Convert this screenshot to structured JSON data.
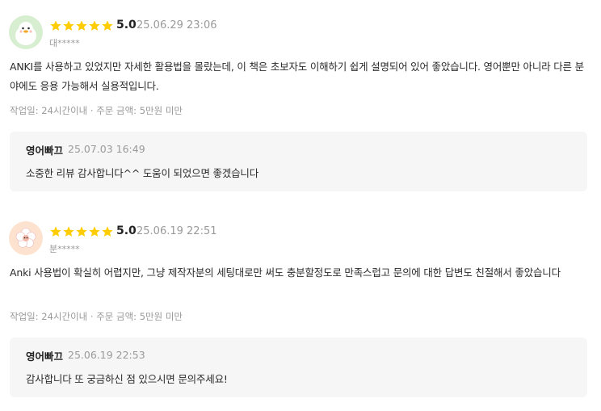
{
  "reviews": [
    {
      "avatar": "duck-avatar-icon",
      "rating": "5.0",
      "stars": 5,
      "date": "25.06.29 23:06",
      "user": "대*****",
      "text": "ANKI를 사용하고 있었지만 자세한 활용법을 몰랐는데, 이 책은 초보자도 이해하기 쉽게 설명되어 있어 좋았습니다. 영어뿐만 아니라 다른 분야에도 응용 가능해서 실용적입니다.",
      "meta": "작업일: 24시간이내 · 주문 금액: 5만원 미만",
      "reply": {
        "name": "영어빠끄",
        "date": "25.07.03 16:49",
        "text": "소중한 리뷰 감사합니다^^ 도움이 되었으면 좋겠습니다"
      }
    },
    {
      "avatar": "flower-avatar-icon",
      "rating": "5.0",
      "stars": 5,
      "date": "25.06.19 22:51",
      "user": "분*****",
      "text": "Anki 사용법이 확실히 어렵지만, 그냥 제작자분의 세팅대로만 써도 충분할정도로 만족스럽고 문의에 대한 답변도 친절해서 좋았습니다",
      "meta": "작업일: 24시간이내 · 주문 금액: 5만원 미만",
      "reply": {
        "name": "영어빠끄",
        "date": "25.06.19 22:53",
        "text": "감사합니다 또 궁금하신 점 있으시면 문의주세요!"
      }
    }
  ],
  "colors": {
    "star": "#FFCC00",
    "muted": "#9a9a9a",
    "reply_bg": "#f6f6f7"
  }
}
